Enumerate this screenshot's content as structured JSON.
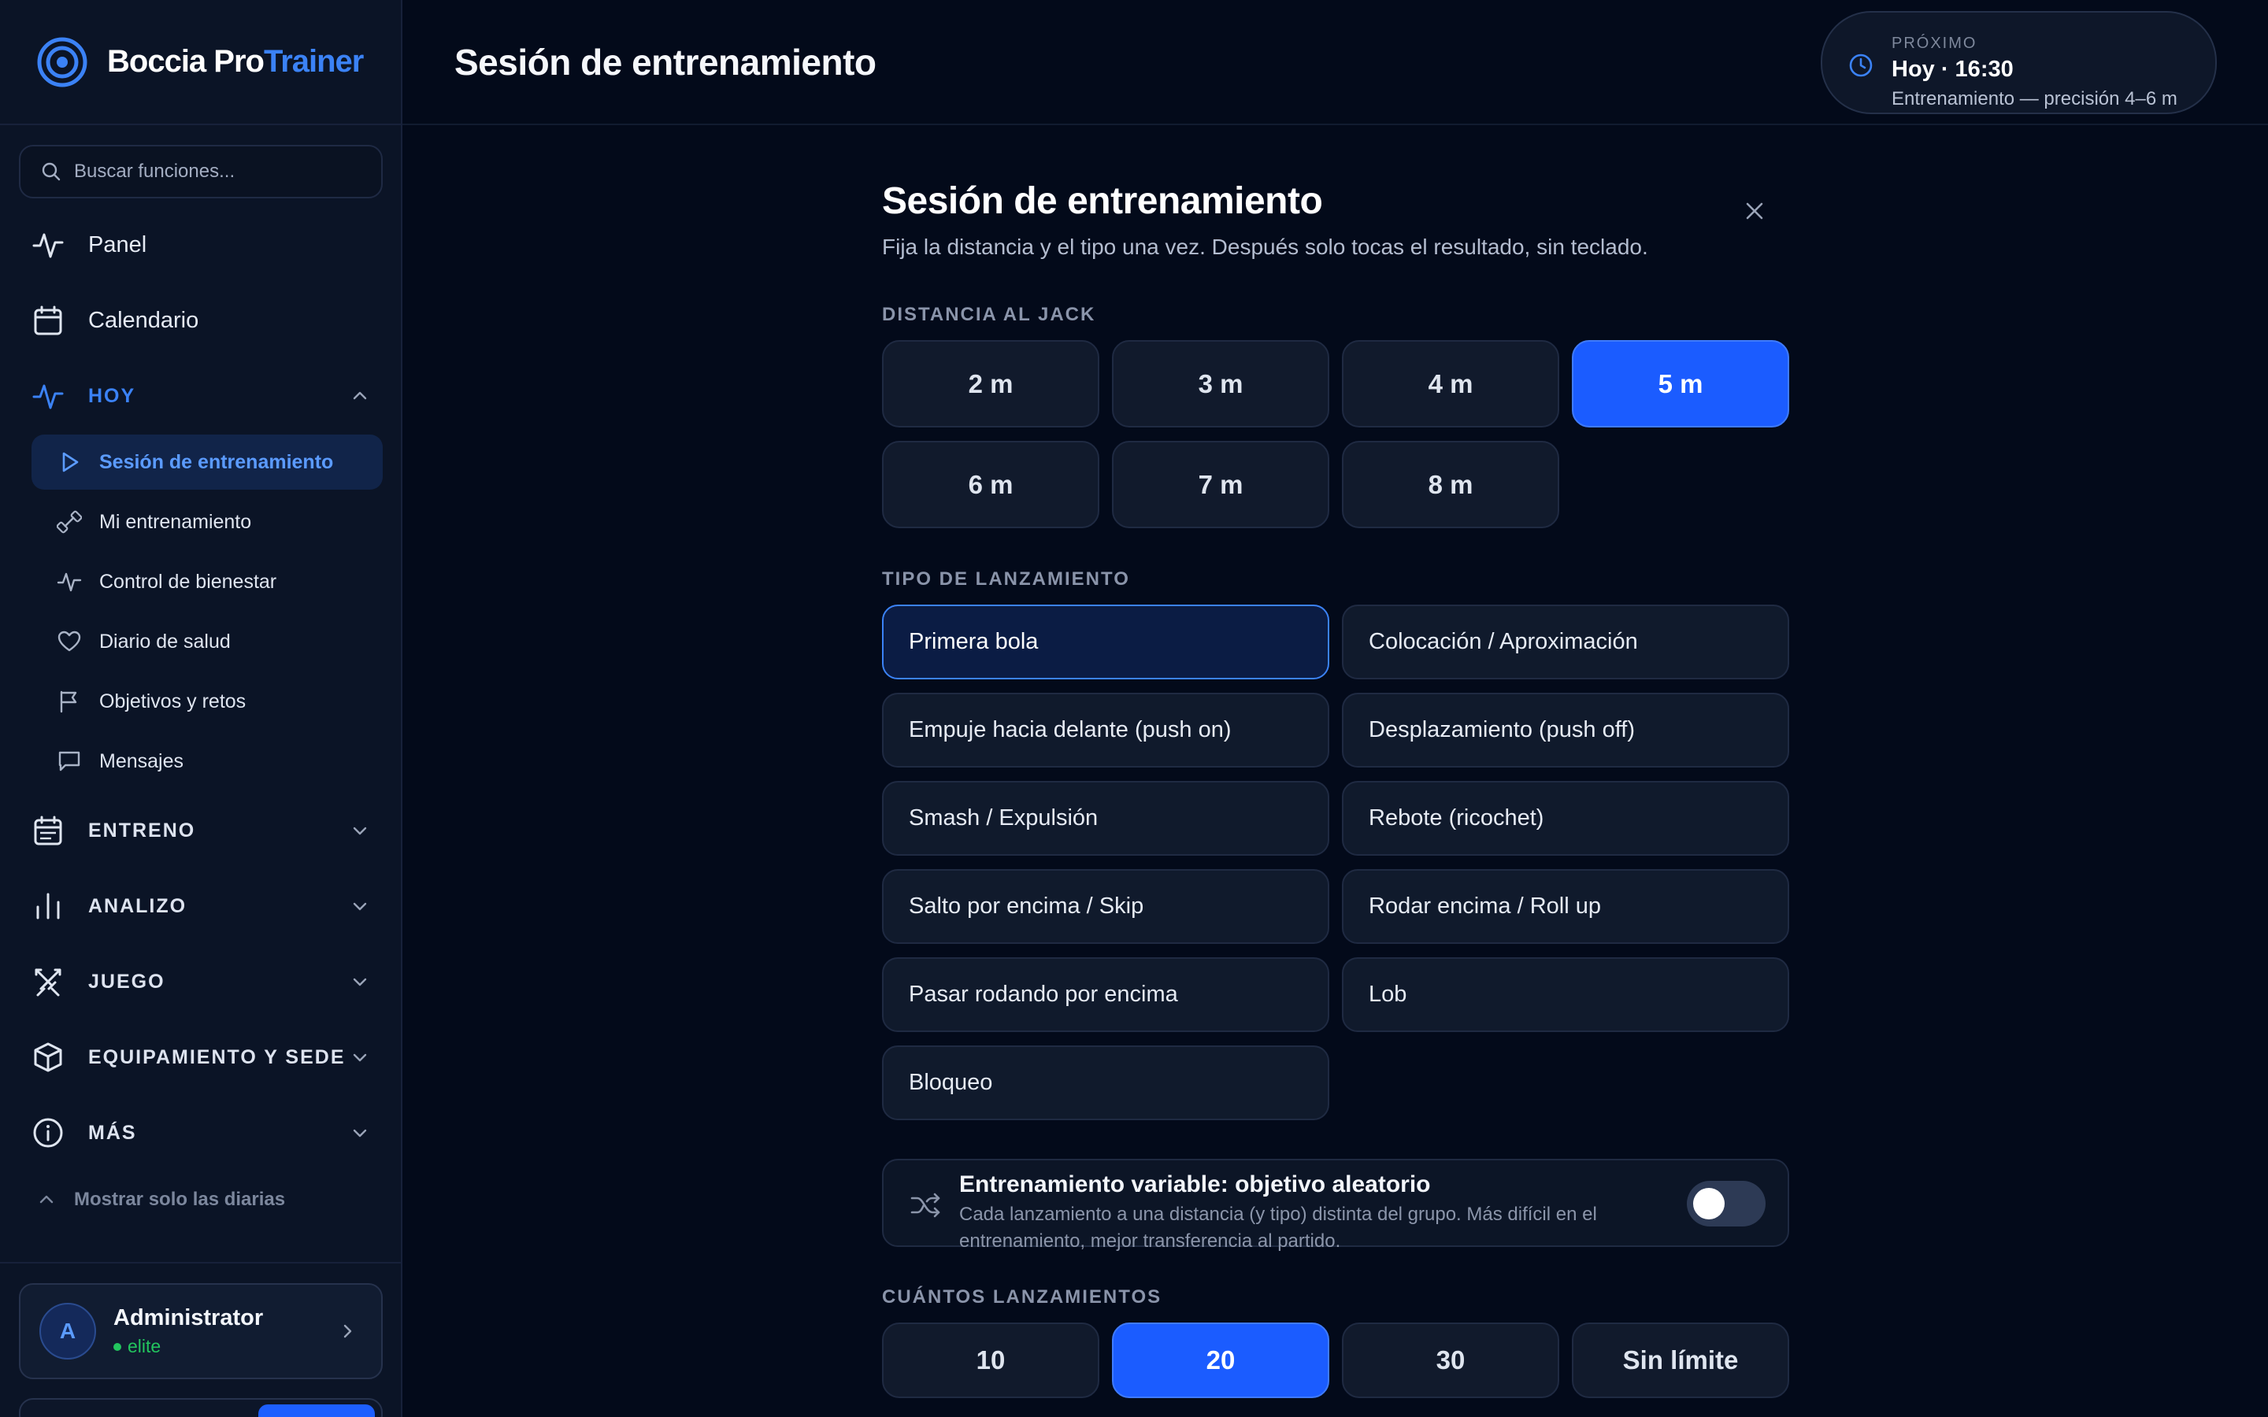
{
  "app": {
    "brand_part1": "Boccia Pro",
    "brand_part2": "Trainer"
  },
  "search": {
    "placeholder": "Buscar funciones..."
  },
  "sidebar": {
    "top_items": [
      {
        "label": "Panel",
        "icon": "activity-icon"
      },
      {
        "label": "Calendario",
        "icon": "calendar-icon"
      }
    ],
    "today_group": {
      "label": "HOY",
      "expanded": true,
      "items": [
        {
          "label": "Sesión de entrenamiento",
          "icon": "play-icon",
          "active": true
        },
        {
          "label": "Mi entrenamiento",
          "icon": "dumbbell-icon"
        },
        {
          "label": "Control de bienestar",
          "icon": "pulse-icon"
        },
        {
          "label": "Diario de salud",
          "icon": "heart-icon"
        },
        {
          "label": "Objetivos y retos",
          "icon": "flag-icon"
        },
        {
          "label": "Mensajes",
          "icon": "message-icon"
        }
      ]
    },
    "groups": [
      {
        "label": "ENTRENO",
        "icon": "calendar-grid-icon"
      },
      {
        "label": "ANALIZO",
        "icon": "bar-chart-icon"
      },
      {
        "label": "JUEGO",
        "icon": "swords-icon"
      },
      {
        "label": "EQUIPAMIENTO Y SEDE",
        "icon": "box-icon"
      },
      {
        "label": "MÁS",
        "icon": "info-icon"
      }
    ],
    "show_daily_label": "Mostrar solo las diarias",
    "user": {
      "initial": "A",
      "name": "Administrator",
      "role": "elite"
    }
  },
  "header": {
    "title": "Sesión de entrenamiento",
    "next": {
      "label": "PRÓXIMO",
      "title": "Hoy · 16:30",
      "subtitle": "Entrenamiento — precisión 4–6 m"
    }
  },
  "session": {
    "title": "Sesión de entrenamiento",
    "subtitle": "Fija la distancia y el tipo una vez. Después solo tocas el resultado, sin teclado.",
    "distance_label": "DISTANCIA AL JACK",
    "distances": [
      "2 m",
      "3 m",
      "4 m",
      "5 m",
      "6 m",
      "7 m",
      "8 m"
    ],
    "selected_distance": "5 m",
    "throw_type_label": "TIPO DE LANZAMIENTO",
    "throw_types": [
      "Primera bola",
      "Colocación / Aproximación",
      "Empuje hacia delante (push on)",
      "Desplazamiento (push off)",
      "Smash / Expulsión",
      "Rebote (ricochet)",
      "Salto por encima / Skip",
      "Rodar encima / Roll up",
      "Pasar rodando por encima",
      "Lob",
      "Bloqueo"
    ],
    "selected_throw_type": "Primera bola",
    "variable": {
      "title": "Entrenamiento variable: objetivo aleatorio",
      "description": "Cada lanzamiento a una distancia (y tipo) distinta del grupo. Más difícil en el entrenamiento, mejor transferencia al partido.",
      "enabled": false
    },
    "count_label": "CUÁNTOS LANZAMIENTOS",
    "counts": [
      "10",
      "20",
      "30",
      "Sin límite"
    ],
    "selected_count": "20"
  },
  "colors": {
    "accent": "#1b5cff",
    "brand_blue": "#3b82f6",
    "background": "#030a1a",
    "sidebar": "#0b1426",
    "success": "#22c55e"
  }
}
